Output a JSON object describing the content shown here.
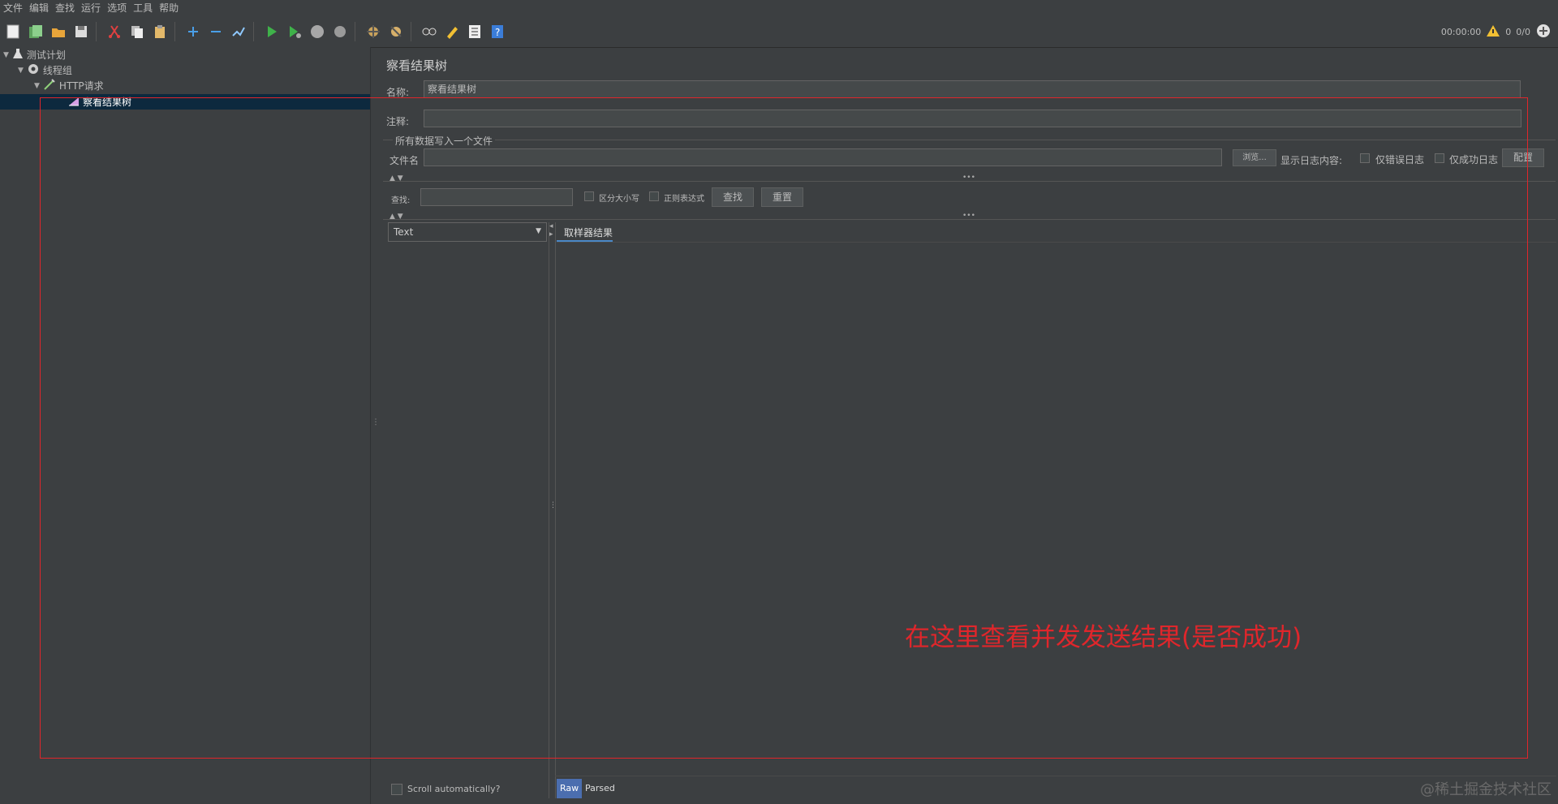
{
  "menu": [
    "文件",
    "编辑",
    "查找",
    "运行",
    "选项",
    "工具",
    "帮助"
  ],
  "toolbar_status": {
    "time": "00:00:00",
    "warnings": "0",
    "threads": "0/0"
  },
  "tree": [
    {
      "label": "测试计划"
    },
    {
      "label": "线程组"
    },
    {
      "label": "HTTP请求"
    },
    {
      "label": "察看结果树"
    }
  ],
  "panel": {
    "title": "察看结果树",
    "name_label": "名称:",
    "name_value": "察看结果树",
    "comment_label": "注释:",
    "comment_value": "",
    "file_section": "所有数据写入一个文件",
    "filename_label": "文件名",
    "filename_value": "",
    "browse_button": "浏览...",
    "log_content_label": "显示日志内容:",
    "errors_only": "仅错误日志",
    "success_only": "仅成功日志",
    "config_button": "配置"
  },
  "search": {
    "label": "查找:",
    "value": "",
    "case_sensitive": "区分大小写",
    "regex": "正则表达式",
    "find_button": "查找",
    "reset_button": "重置"
  },
  "results": {
    "renderer": "Text",
    "tab": "取样器结果",
    "scroll_auto": "Scroll automatically?",
    "bottom_tabs": [
      "Raw",
      "Parsed"
    ]
  },
  "annotation": {
    "text": "在这里查看并发发送结果(是否成功)",
    "color": "#e0262b"
  },
  "watermark": "@稀土掘金技术社区"
}
